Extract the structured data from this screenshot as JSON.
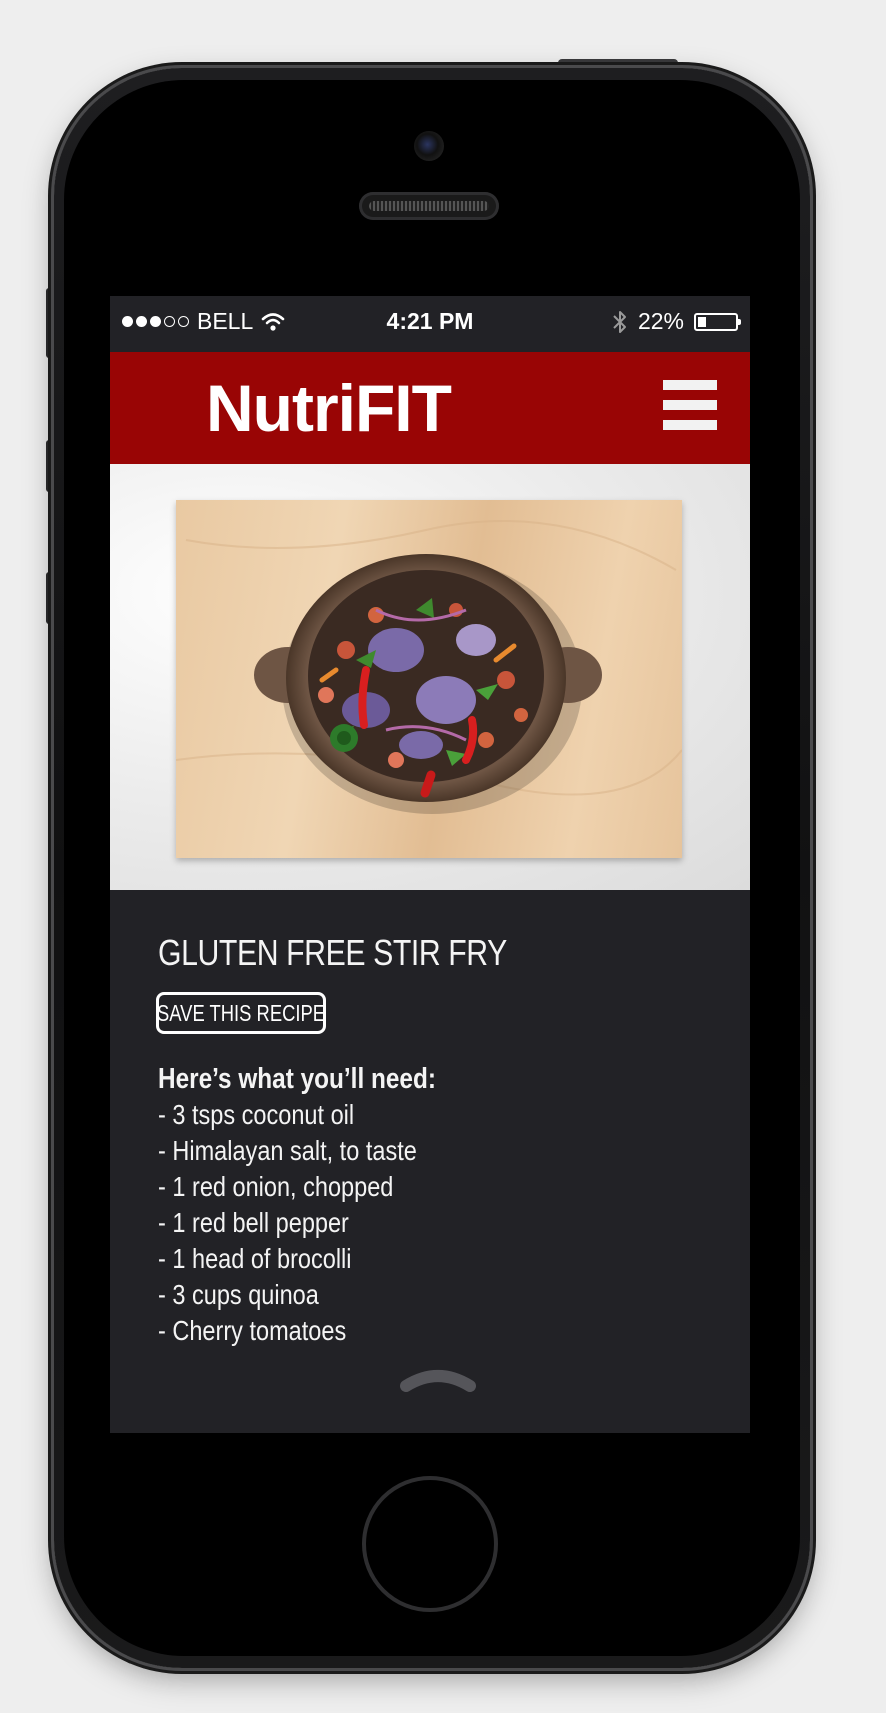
{
  "status_bar": {
    "carrier": "BELL",
    "signal_bars_filled": 3,
    "signal_bars_total": 5,
    "time": "4:21 PM",
    "battery_percent": "22%",
    "battery_level": 0.22,
    "icons": [
      "wifi-icon",
      "bluetooth-icon",
      "battery-icon"
    ]
  },
  "header": {
    "title": "NutriFIT",
    "menu_icon": "hamburger-menu-icon",
    "color": "#990505"
  },
  "hero": {
    "image": "stir fry bowl on cutting board"
  },
  "recipe": {
    "title": "GLUTEN FREE STIR FRY",
    "save_label": "SAVE THIS RECIPE",
    "ingredients_heading": "Here’s what you’ll need:",
    "ingredients": [
      "- 3 tsps coconut oil",
      "- Himalayan salt, to taste",
      "- 1  red onion, chopped",
      "- 1 red bell pepper",
      "- 1 head of brocolli",
      "- 3 cups quinoa",
      "- Cherry tomatoes"
    ]
  },
  "colors": {
    "screen_background": "#222226",
    "text": "#f4f4f4",
    "accent": "#990505"
  }
}
